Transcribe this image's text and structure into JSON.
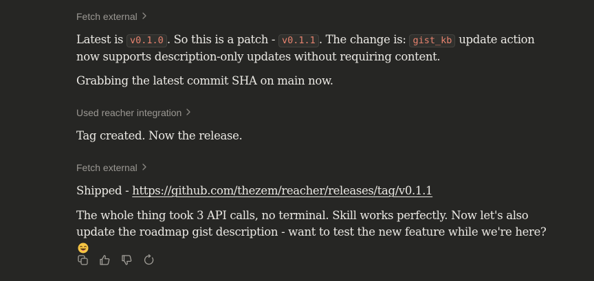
{
  "tools": [
    {
      "label": "Fetch external",
      "icon": "chevron-right-icon"
    },
    {
      "label": "Used reacher integration",
      "icon": "chevron-right-icon"
    },
    {
      "label": "Fetch external",
      "icon": "chevron-right-icon"
    }
  ],
  "para1": {
    "t1": "Latest is ",
    "code1": "v0.1.0",
    "t2": ". So this is a patch - ",
    "code2": "v0.1.1",
    "t3": ". The change is: ",
    "code3": "gist_kb",
    "t4": " update action now supports description-only updates without requiring content."
  },
  "para2": "Grabbing the latest commit SHA on main now.",
  "para3": "Tag created. Now the release.",
  "para4": {
    "prefix": "Shipped - ",
    "link": "https://github.com/thezem/reacher/releases/tag/v0.1.1"
  },
  "para5": {
    "text": "The whole thing took 3 API calls, no terminal. Skill works perfectly. Now let's also update the roadmap gist description - want to test the new feature while we're here?",
    "emoji": "grinning-face-with-tongue-emoji"
  },
  "actions": [
    {
      "name": "copy-icon"
    },
    {
      "name": "thumbs-up-icon"
    },
    {
      "name": "thumbs-down-icon"
    },
    {
      "name": "retry-icon"
    }
  ],
  "colors": {
    "background": "#262624",
    "text": "#ebe9e4",
    "muted": "#9b9893",
    "code": "#e8836f"
  }
}
